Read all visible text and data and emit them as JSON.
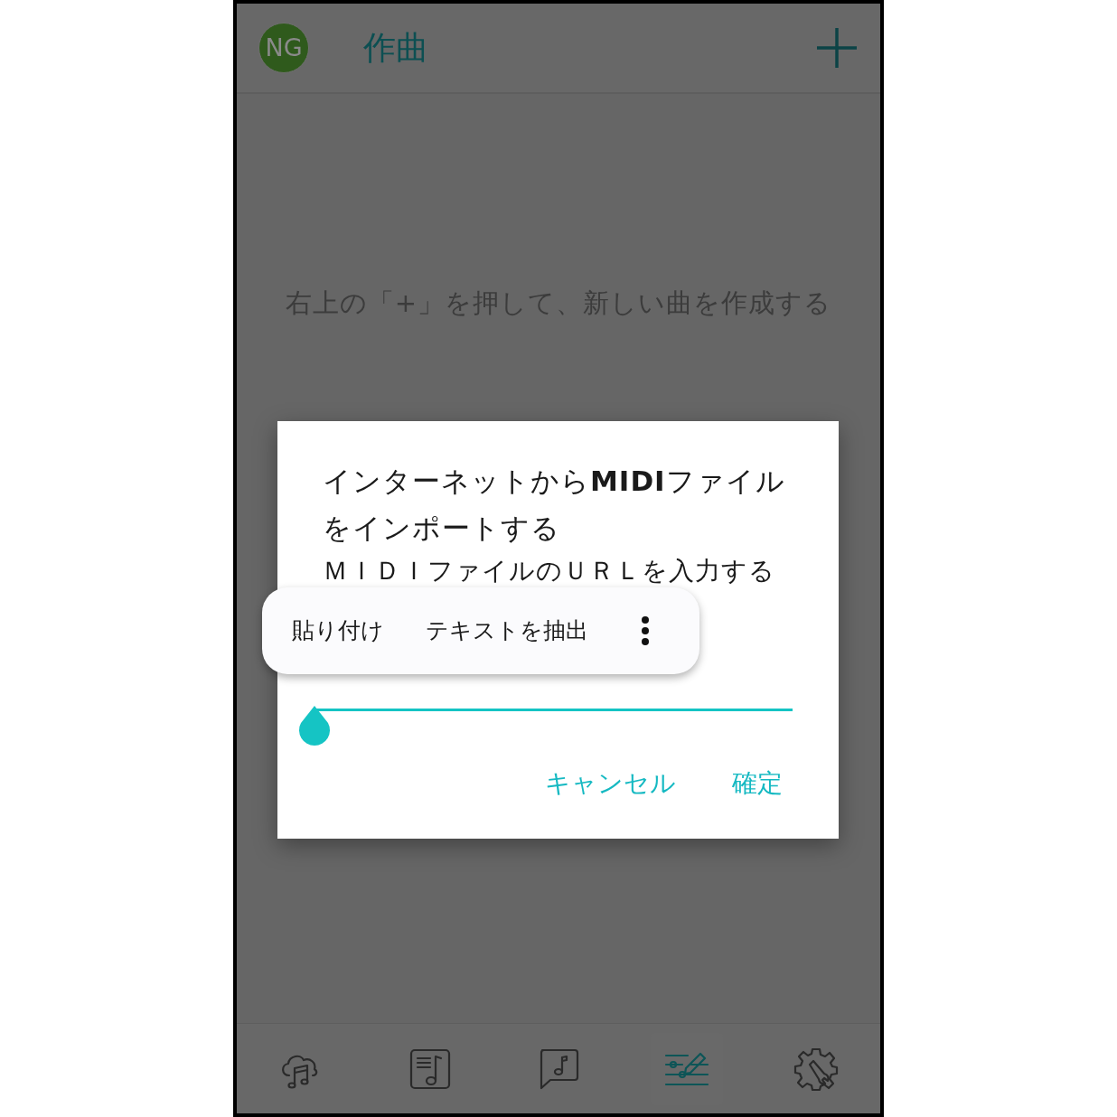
{
  "app_bar": {
    "avatar": "NG",
    "title": "作曲"
  },
  "empty_message": "右上の「+」を押して、新しい曲を作成する",
  "dialog": {
    "title": "インターネットから**MIDI**ファイルをインポートする",
    "message": "ＭＩＤＩファイルのＵＲＬを入力する",
    "url_field": {
      "focused": true
    },
    "buttons": [
      "キャンセル",
      "確定"
    ]
  },
  "text_menu": {
    "items": [
      "貼り付け",
      "テキストを抽出"
    ]
  },
  "bottom_nav": [
    {
      "kind": "cloud",
      "selected": false
    },
    {
      "kind": "sheet",
      "selected": false
    },
    {
      "kind": "chat",
      "selected": false
    },
    {
      "kind": "compose",
      "selected": true
    },
    {
      "kind": "tools",
      "selected": false
    }
  ]
}
